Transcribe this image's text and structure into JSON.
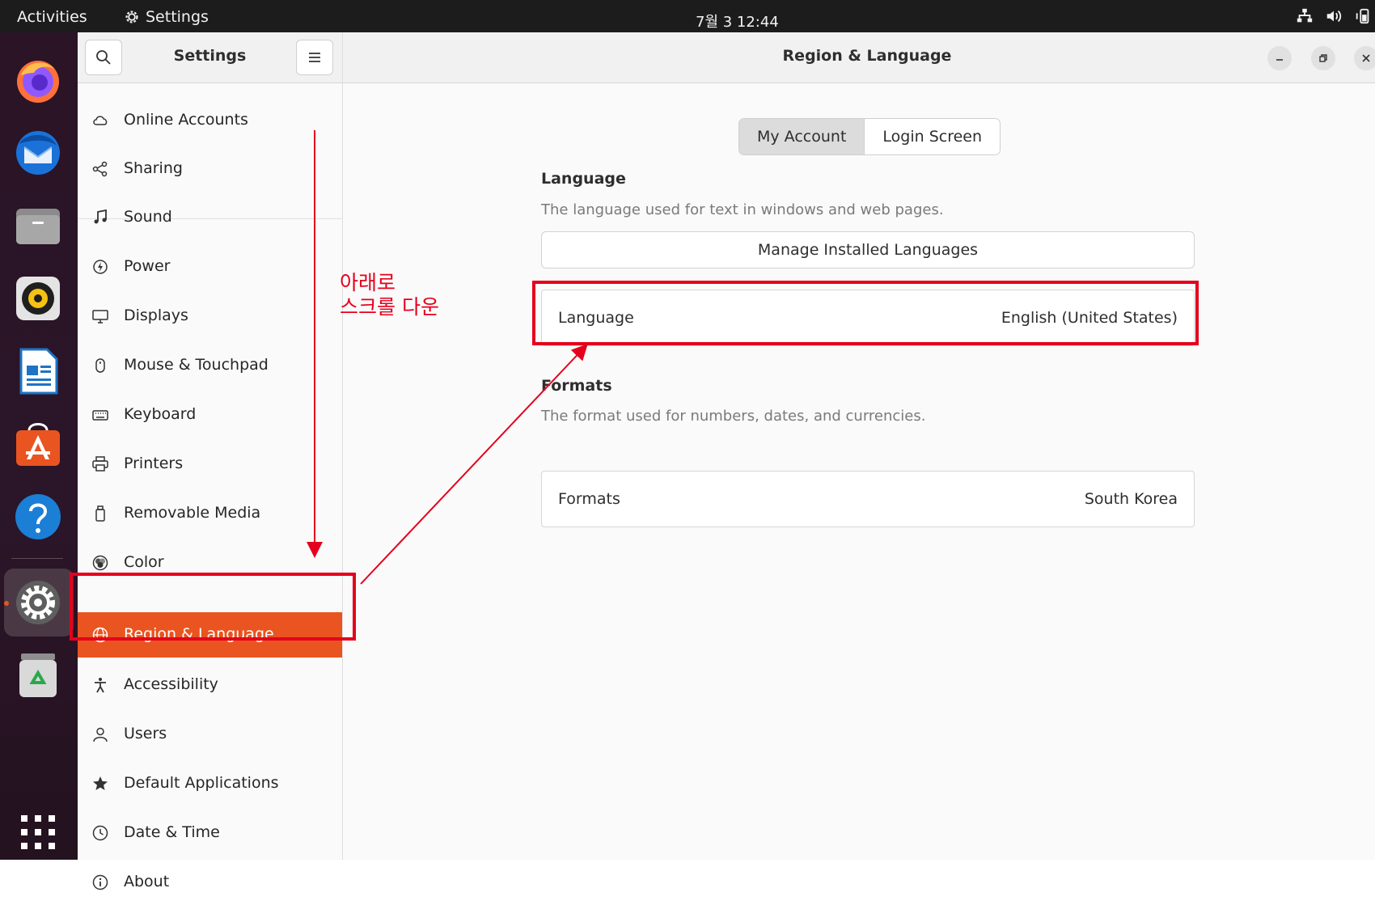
{
  "topbar": {
    "activities": "Activities",
    "app_name": "Settings",
    "clock": "7월 3 12:44"
  },
  "dock": {
    "apps": [
      "firefox-icon",
      "thunderbird-icon",
      "files-icon",
      "rhythmbox-icon",
      "writer-icon",
      "software-icon",
      "help-icon",
      "settings-icon",
      "trash-icon",
      "show-apps-icon"
    ]
  },
  "sidebar": {
    "title": "Settings",
    "items": [
      {
        "label": "Online Accounts",
        "icon": "cloud-icon"
      },
      {
        "label": "Sharing",
        "icon": "share-icon"
      },
      {
        "label": "Sound",
        "icon": "music-note-icon"
      },
      {
        "label": "Power",
        "icon": "power-icon"
      },
      {
        "label": "Displays",
        "icon": "display-icon"
      },
      {
        "label": "Mouse & Touchpad",
        "icon": "mouse-icon"
      },
      {
        "label": "Keyboard",
        "icon": "keyboard-icon"
      },
      {
        "label": "Printers",
        "icon": "printer-icon"
      },
      {
        "label": "Removable Media",
        "icon": "usb-icon"
      },
      {
        "label": "Color",
        "icon": "color-icon"
      },
      {
        "label": "Region & Language",
        "icon": "globe-icon",
        "active": true
      },
      {
        "label": "Accessibility",
        "icon": "accessibility-icon"
      },
      {
        "label": "Users",
        "icon": "users-icon"
      },
      {
        "label": "Default Applications",
        "icon": "star-icon"
      },
      {
        "label": "Date & Time",
        "icon": "clock-icon"
      },
      {
        "label": "About",
        "icon": "info-icon"
      }
    ]
  },
  "main": {
    "title": "Region & Language",
    "tabs": [
      {
        "label": "My Account",
        "selected": true
      },
      {
        "label": "Login Screen",
        "selected": false
      }
    ],
    "language": {
      "heading": "Language",
      "description": "The language used for text in windows and web pages.",
      "manage_button": "Manage Installed Languages",
      "row_label": "Language",
      "row_value": "English (United States)"
    },
    "formats": {
      "heading": "Formats",
      "description": "The format used for numbers, dates, and currencies.",
      "row_label": "Formats",
      "row_value": "South Korea"
    }
  },
  "annotation": {
    "line1": "아래로",
    "line2": "스크롤 다운",
    "color": "#e5001c"
  },
  "colors": {
    "accent": "#e95420",
    "topbar": "#1c1c1c",
    "dock": "#2a1426"
  }
}
